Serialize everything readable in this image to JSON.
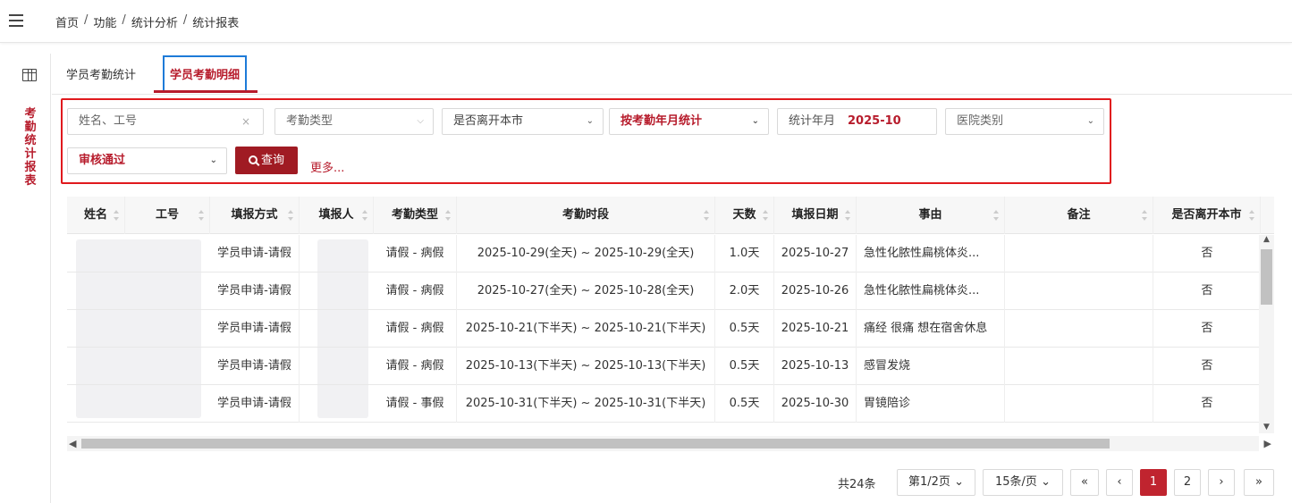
{
  "breadcrumb": [
    "首页",
    "功能",
    "统计分析",
    "统计报表"
  ],
  "breadcrumb_sep": "/",
  "sidebar_title": [
    "考",
    "勤",
    "统",
    "计",
    "报",
    "表"
  ],
  "tabs": [
    {
      "label": "学员考勤统计"
    },
    {
      "label": "学员考勤明细"
    }
  ],
  "filters": {
    "name_placeholder": "姓名、工号",
    "clear_icon": "×",
    "attendance_type": "考勤类型",
    "leave_city": "是否离开本市",
    "stat_mode": "按考勤年月统计",
    "stat_month_label": "统计年月",
    "stat_month_value": "2025-10",
    "hospital_type": "医院类别",
    "audit_status": "审核通过",
    "search_label": "查询",
    "more_label": "更多..."
  },
  "table": {
    "headers": [
      "姓名",
      "工号",
      "填报方式",
      "填报人",
      "考勤类型",
      "考勤时段",
      "天数",
      "填报日期",
      "事由",
      "备注",
      "是否离开本市"
    ],
    "rows": [
      {
        "method": "学员申请-请假",
        "type": "请假 - 病假",
        "period": "2025-10-29(全天) ~ 2025-10-29(全天)",
        "days": "1.0天",
        "date": "2025-10-27",
        "reason": "急性化脓性扁桃体炎...",
        "remark": "",
        "leave": "否"
      },
      {
        "method": "学员申请-请假",
        "type": "请假 - 病假",
        "period": "2025-10-27(全天) ~ 2025-10-28(全天)",
        "days": "2.0天",
        "date": "2025-10-26",
        "reason": "急性化脓性扁桃体炎...",
        "remark": "",
        "leave": "否"
      },
      {
        "method": "学员申请-请假",
        "type": "请假 - 病假",
        "period": "2025-10-21(下半天) ~ 2025-10-21(下半天)",
        "days": "0.5天",
        "date": "2025-10-21",
        "reason": "痛经 很痛 想在宿舍休息",
        "remark": "",
        "leave": "否"
      },
      {
        "method": "学员申请-请假",
        "type": "请假 - 病假",
        "period": "2025-10-13(下半天) ~ 2025-10-13(下半天)",
        "days": "0.5天",
        "date": "2025-10-13",
        "reason": "感冒发烧",
        "remark": "",
        "leave": "否"
      },
      {
        "method": "学员申请-请假",
        "type": "请假 - 事假",
        "period": "2025-10-31(下半天) ~ 2025-10-31(下半天)",
        "days": "0.5天",
        "date": "2025-10-30",
        "reason": "胃镜陪诊",
        "remark": "",
        "leave": "否"
      }
    ]
  },
  "pagination": {
    "total": "共24条",
    "page_select": "第1/2页",
    "page_size": "15条/页",
    "first": "«",
    "prev": "‹",
    "pages": [
      "1",
      "2"
    ],
    "next": "›",
    "last": "»"
  },
  "colors": {
    "accent": "#b71c2c",
    "highlight_border": "#e0191d",
    "focus_border": "#1e7bd8"
  }
}
